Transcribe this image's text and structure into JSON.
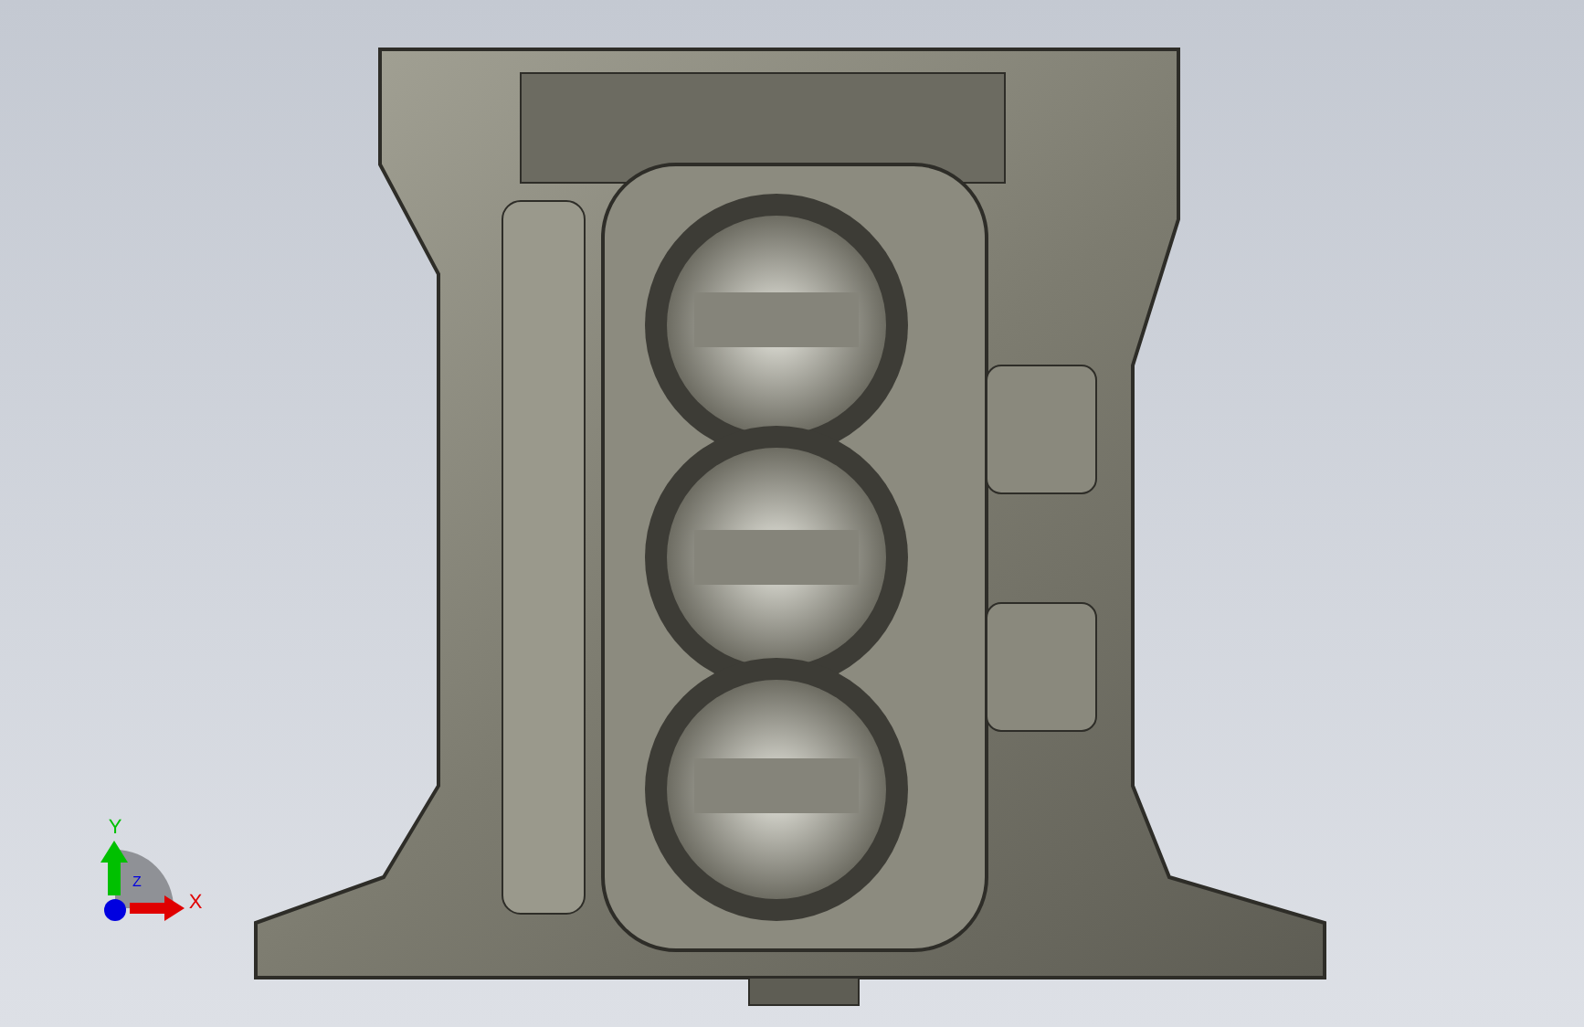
{
  "viewport": {
    "triad": {
      "axes": [
        {
          "kind": "vertical",
          "label": "Y",
          "color": "#00c000"
        },
        {
          "kind": "horizontal",
          "label": "X",
          "color": "#e00000"
        },
        {
          "kind": "depth",
          "label": "Z",
          "color": "#0000e0"
        }
      ]
    }
  }
}
